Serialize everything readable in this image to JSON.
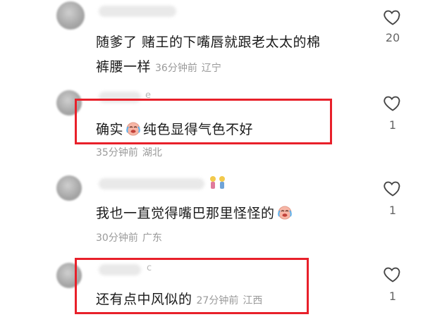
{
  "comments": [
    {
      "text": "随爹了 赌王的下嘴唇就跟老太太的棉",
      "text2": "裤腰一样",
      "time": "36分钟前",
      "location": "辽宁",
      "likes": "20"
    },
    {
      "name_tail": "e",
      "text_before": "确实",
      "text_after": "纯色显得气色不好",
      "emoji": "crying-laughing-face",
      "time": "35分钟前",
      "location": "湖北",
      "likes": "1"
    },
    {
      "text_before": "我也一直觉得嘴巴那里怪怪的",
      "emoji": "crying-laughing-face",
      "time": "30分钟前",
      "location": "广东",
      "likes": "1"
    },
    {
      "name_tail": "c",
      "text": "还有点中风似的",
      "time": "27分钟前",
      "location": "江西",
      "likes": "1"
    }
  ],
  "colors": {
    "highlight": "#e8202a",
    "meta": "#9a9a9a",
    "text": "#1a1a1a"
  }
}
